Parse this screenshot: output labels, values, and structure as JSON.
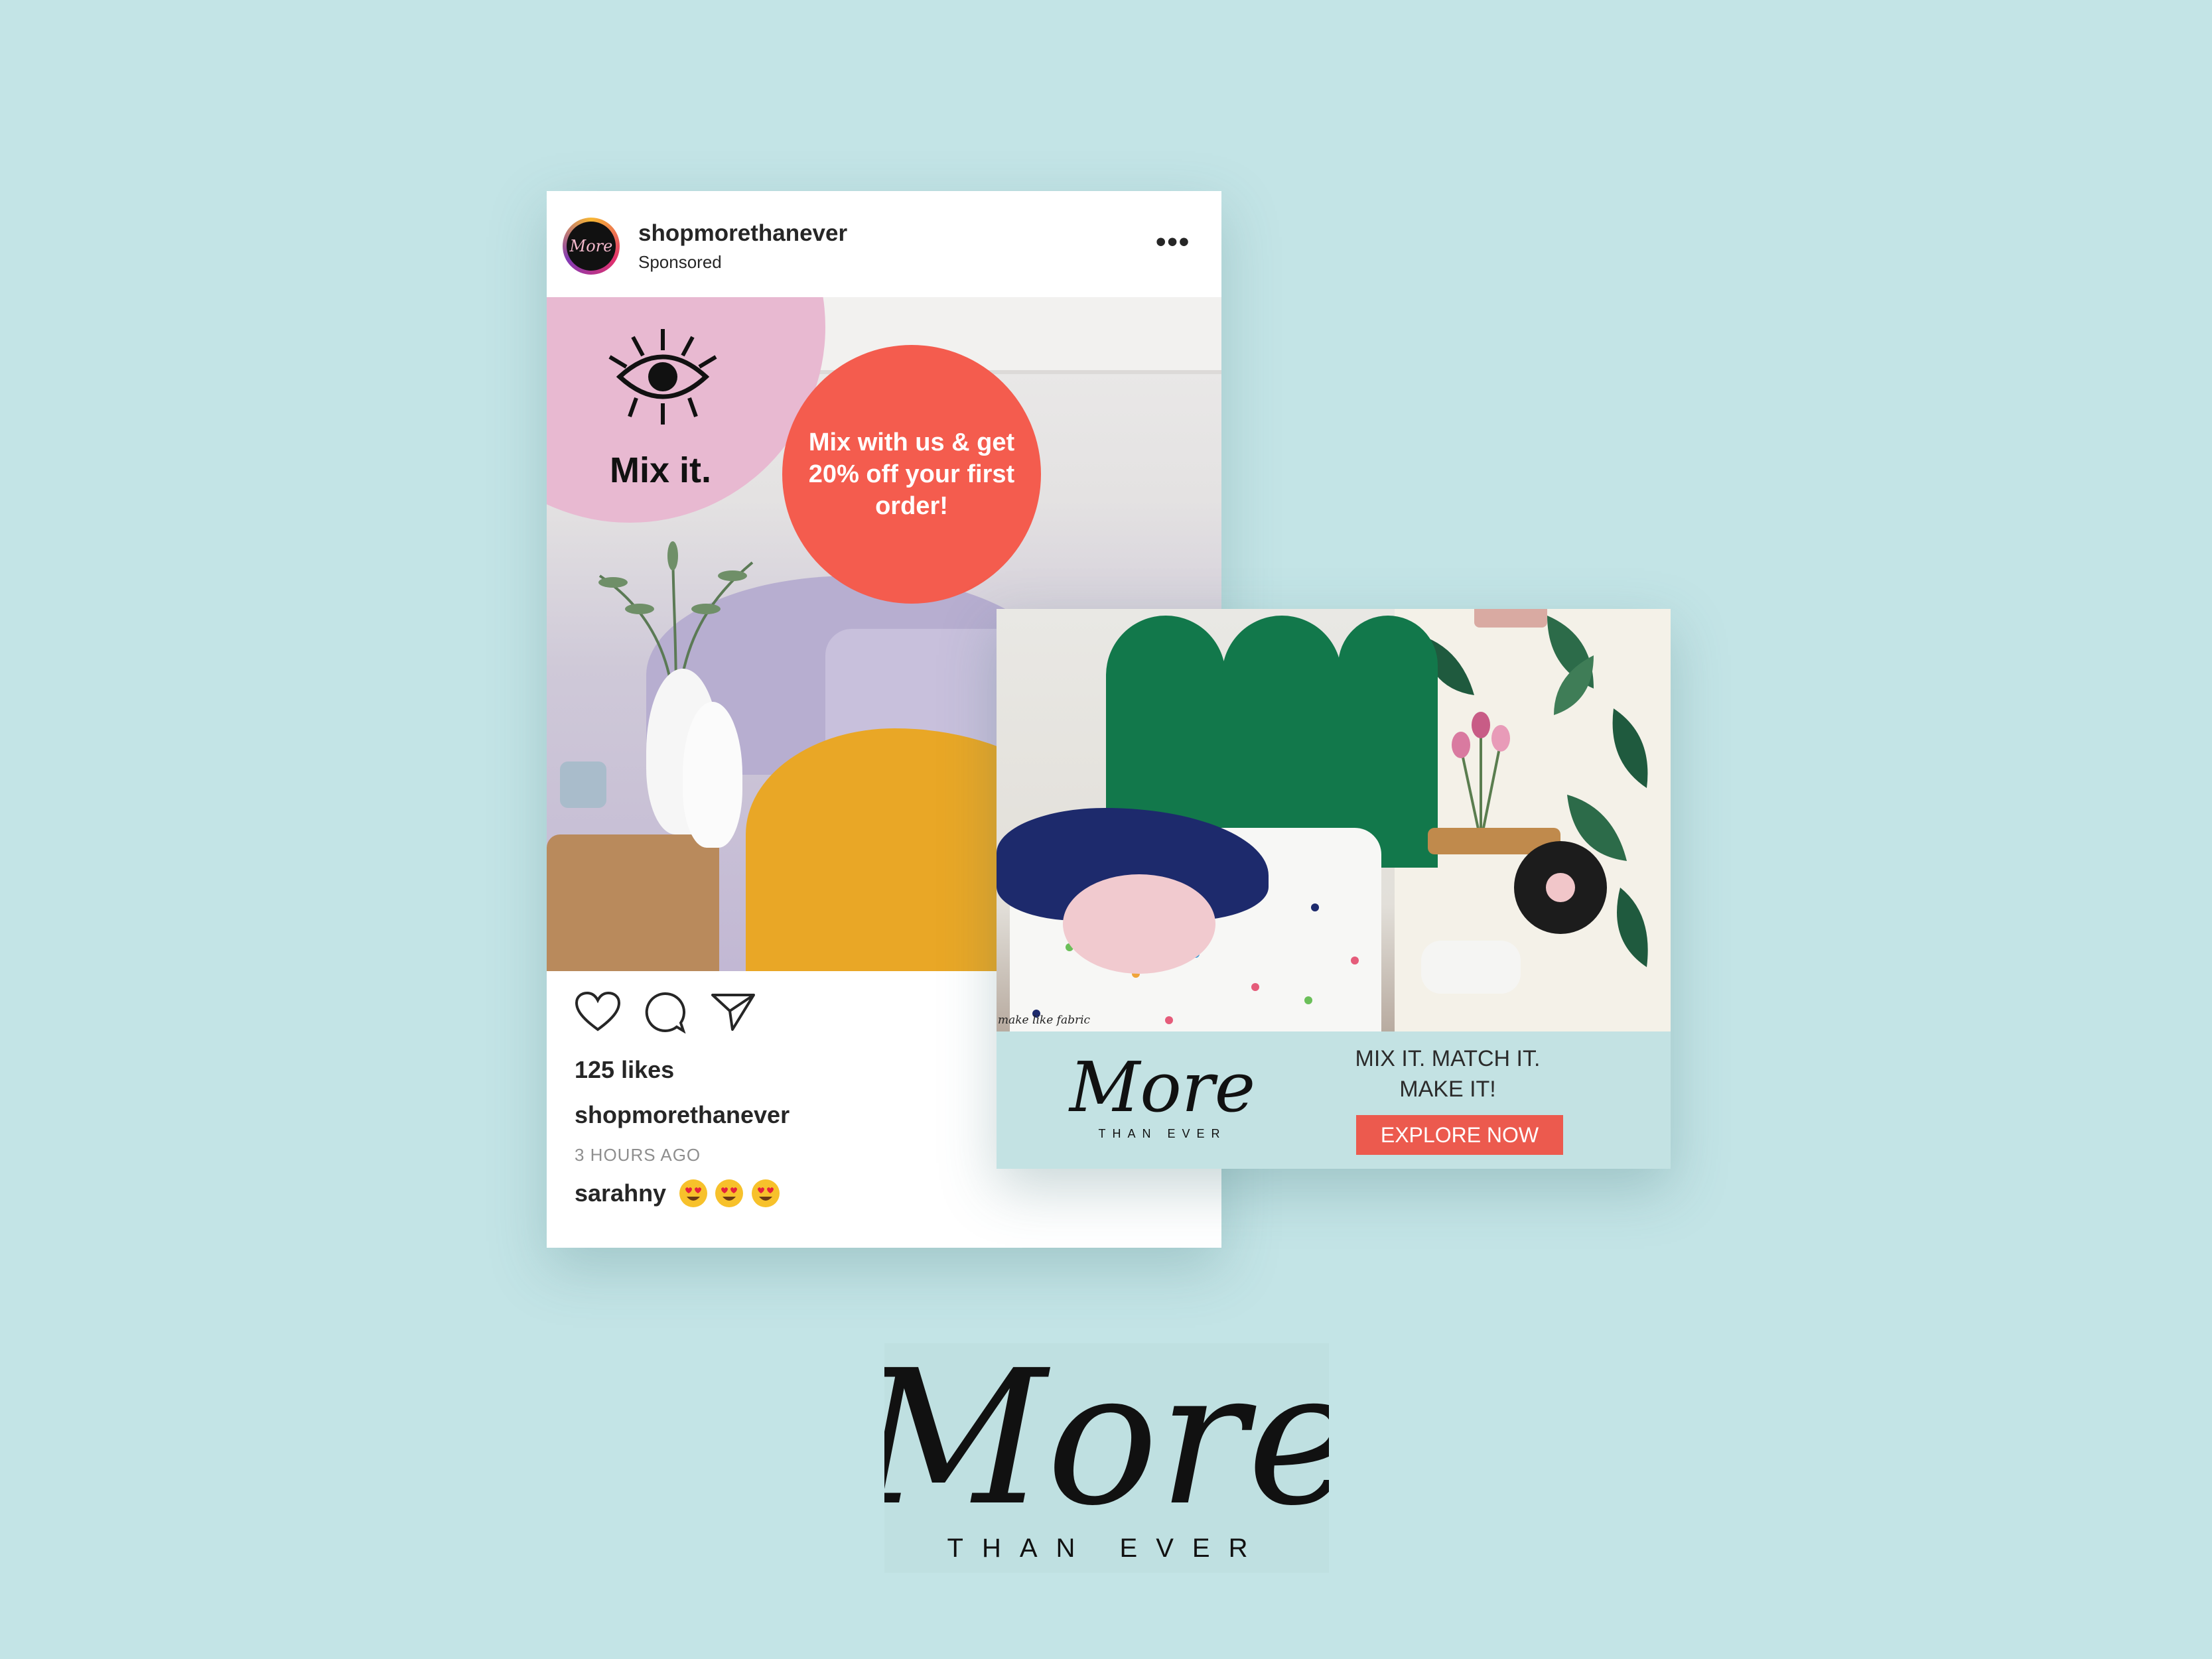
{
  "instagram_post": {
    "username": "shopmorethanever",
    "sponsored_label": "Sponsored",
    "avatar_text": "More",
    "image": {
      "headline": "Mix it.",
      "promo": "Mix with us & get 20% off your first order!"
    },
    "likes": "125 likes",
    "caption_username": "shopmorethanever",
    "timestamp": "3 HOURS AGO",
    "comment_user": "sarahny",
    "icons": [
      "heart-icon",
      "comment-icon",
      "share-icon",
      "more-options-icon"
    ]
  },
  "banner_ad": {
    "image_caption": "make like fabric",
    "logo": {
      "script": "More",
      "sub": "THAN EVER"
    },
    "tagline_line1": "MIX IT. MATCH IT.",
    "tagline_line2": "MAKE IT!",
    "cta": "EXPLORE NOW"
  },
  "brand_logo": {
    "script": "More",
    "sub": "THAN EVER"
  },
  "colors": {
    "background": "#c3e4e6",
    "pink": "#e8b9d1",
    "coral": "#f45c4e",
    "cta": "#ec5a4e",
    "headboard_green": "#12784b"
  }
}
